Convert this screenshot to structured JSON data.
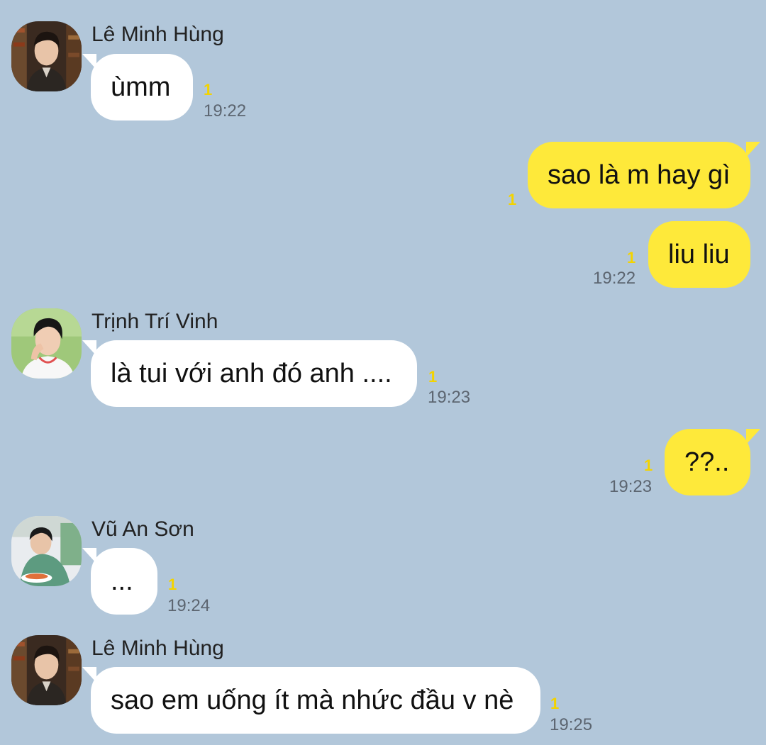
{
  "colors": {
    "background": "#b2c7da",
    "incoming_bubble": "#ffffff",
    "outgoing_bubble": "#fee93a",
    "unread_count": "#f3d300",
    "time_text": "#5c6570"
  },
  "messages": [
    {
      "direction": "in",
      "sender": "Lê Minh Hùng",
      "avatar": "avatar-le-minh-hung",
      "text": "ùmm",
      "unread": "1",
      "time": "19:22"
    },
    {
      "direction": "out",
      "text": "sao là m hay gì",
      "unread": "1",
      "time": ""
    },
    {
      "direction": "out",
      "text": "liu liu",
      "unread": "1",
      "time": "19:22"
    },
    {
      "direction": "in",
      "sender": "Trịnh Trí Vinh",
      "avatar": "avatar-trinh-tri-vinh",
      "text": "là tui với anh đó anh ....",
      "unread": "1",
      "time": "19:23"
    },
    {
      "direction": "out",
      "text": "??..",
      "unread": "1",
      "time": "19:23"
    },
    {
      "direction": "in",
      "sender": "Vũ An Sơn",
      "avatar": "avatar-vu-an-son",
      "text": "...",
      "unread": "1",
      "time": "19:24"
    },
    {
      "direction": "in",
      "sender": "Lê Minh Hùng",
      "avatar": "avatar-le-minh-hung",
      "text": "sao em uống ít mà nhức đầu v nè",
      "unread": "1",
      "time": "19:25"
    }
  ]
}
